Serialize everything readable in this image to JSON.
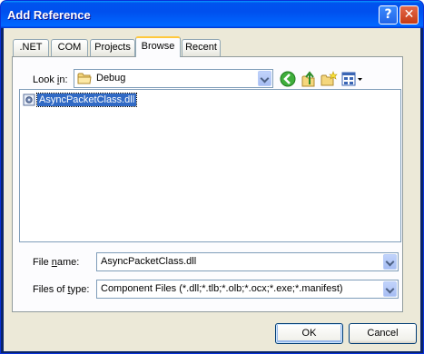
{
  "window": {
    "title": "Add Reference"
  },
  "tabs": [
    {
      "label": ".NET"
    },
    {
      "label": "COM"
    },
    {
      "label": "Projects"
    },
    {
      "label": "Browse"
    },
    {
      "label": "Recent"
    }
  ],
  "active_tab": "Browse",
  "look_in": {
    "label_pre": "Look ",
    "label_hotkey": "i",
    "label_post": "n:",
    "value": "Debug"
  },
  "files": [
    {
      "name": "AsyncPacketClass.dll",
      "selected": true
    }
  ],
  "file_name": {
    "label_pre": "File ",
    "label_hotkey": "n",
    "label_post": "ame:",
    "value": "AsyncPacketClass.dll"
  },
  "file_type": {
    "label_pre": "Files of ",
    "label_hotkey": "t",
    "label_post": "ype:",
    "value": "Component Files (*.dll;*.tlb;*.olb;*.ocx;*.exe;*.manifest)"
  },
  "buttons": {
    "ok": "OK",
    "cancel": "Cancel"
  },
  "icons": {
    "help": "?",
    "close": "✕"
  },
  "colors": {
    "titlebar": "#0053ee",
    "selection": "#316ac5",
    "dialog_bg": "#ece9d8"
  }
}
